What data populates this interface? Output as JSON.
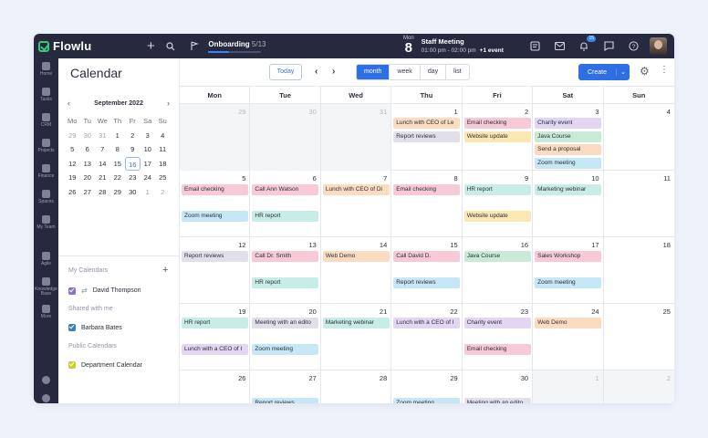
{
  "app": {
    "name": "Flowlu"
  },
  "topbar": {
    "onboarding_label": "Onboarding",
    "onboarding_count": "5/13",
    "onboarding_progress": 0.385,
    "meeting_day_name": "Mon",
    "meeting_day_num": "8",
    "meeting_title": "Staff Meeting",
    "meeting_time": "01:00 pm - 02:00 pm",
    "meeting_extra": "+1 event",
    "notif_badge": "15"
  },
  "sidenav": [
    {
      "label": "Home",
      "icon": "home-icon"
    },
    {
      "label": "Tasks",
      "icon": "tasks-icon"
    },
    {
      "label": "CRM",
      "icon": "crm-icon"
    },
    {
      "label": "Projects",
      "icon": "projects-icon"
    },
    {
      "label": "Finance",
      "icon": "finance-icon"
    },
    {
      "label": "Spaces",
      "icon": "spaces-icon"
    },
    {
      "label": "My Team",
      "icon": "team-icon"
    },
    {
      "label": "Agile",
      "icon": "agile-icon"
    },
    {
      "label": "Knowledge Base",
      "icon": "knowledge-icon"
    },
    {
      "label": "More",
      "icon": "more-icon"
    }
  ],
  "page": {
    "title": "Calendar"
  },
  "mini_calendar": {
    "month_label": "September 2022",
    "dows": [
      "Mo",
      "Tu",
      "We",
      "Th",
      "Fr",
      "Sa",
      "Su"
    ],
    "weeks": [
      [
        "29",
        "30",
        "31",
        "1",
        "2",
        "3",
        "4"
      ],
      [
        "5",
        "6",
        "7",
        "8",
        "9",
        "10",
        "11"
      ],
      [
        "12",
        "13",
        "14",
        "15",
        "16",
        "17",
        "18"
      ],
      [
        "19",
        "20",
        "21",
        "22",
        "23",
        "24",
        "25"
      ],
      [
        "26",
        "27",
        "28",
        "29",
        "30",
        "1",
        "2"
      ]
    ],
    "today": "16"
  },
  "calendars": {
    "my_label": "My Calendars",
    "my_items": [
      {
        "name": "David Thompson",
        "color": "#8b6fc9"
      }
    ],
    "shared_label": "Shared with me",
    "shared_items": [
      {
        "name": "Barbara Bates",
        "color": "#3a7fc1"
      }
    ],
    "public_label": "Public Calendars",
    "public_items": [
      {
        "name": "Department Calendar",
        "color": "#c9cf2e"
      }
    ]
  },
  "toolbar": {
    "today_label": "Today",
    "views": [
      "month",
      "week",
      "day",
      "list"
    ],
    "active_view": "month",
    "create_label": "Create"
  },
  "grid": {
    "dows": [
      "Mon",
      "Tue",
      "Wed",
      "Thu",
      "Fri",
      "Sat",
      "Sun"
    ],
    "weeks": [
      [
        {
          "n": "29",
          "out": true,
          "events": []
        },
        {
          "n": "30",
          "out": true,
          "events": []
        },
        {
          "n": "31",
          "out": true,
          "events": []
        },
        {
          "n": "1",
          "events": [
            {
              "t": "Lunch with CEO of Le",
              "c": "#fbdcc0"
            },
            {
              "t": "Report reviews",
              "c": "#e1e0ea"
            }
          ]
        },
        {
          "n": "2",
          "events": [
            {
              "t": "Email checking",
              "c": "#f8c9d6"
            },
            {
              "t": "Website update",
              "c": "#fbe7b2"
            }
          ]
        },
        {
          "n": "3",
          "events": [
            {
              "t": "Charity event",
              "c": "#e3d6f3"
            },
            {
              "t": "Java Course",
              "c": "#c8ead7"
            },
            {
              "t": "Send a proposal",
              "c": "#fbdcc0"
            },
            {
              "t": "Zoom meeting",
              "c": "#c6e7f6"
            }
          ]
        },
        {
          "n": "4",
          "events": []
        }
      ],
      [
        {
          "n": "5",
          "events": [
            {
              "t": "Email checking",
              "c": "#f8c9d6"
            },
            {
              "t": "Zoom meeting",
              "c": "#c6e7f6",
              "slot": 2
            }
          ]
        },
        {
          "n": "6",
          "events": [
            {
              "t": "Call Ann Watson",
              "c": "#f8c9d6"
            },
            {
              "t": "HR report",
              "c": "#c7ede6",
              "slot": 2
            }
          ]
        },
        {
          "n": "7",
          "events": [
            {
              "t": "Lunch with CEO of Di",
              "c": "#fbdcc0"
            }
          ]
        },
        {
          "n": "8",
          "events": [
            {
              "t": "Email checking",
              "c": "#f8c9d6"
            }
          ]
        },
        {
          "n": "9",
          "events": [
            {
              "t": "HR report",
              "c": "#c7ede6"
            },
            {
              "t": "Website update",
              "c": "#fbe7b2",
              "slot": 2
            }
          ]
        },
        {
          "n": "10",
          "events": [
            {
              "t": "Marketing webinar",
              "c": "#c7ede6"
            }
          ]
        },
        {
          "n": "11",
          "events": []
        }
      ],
      [
        {
          "n": "12",
          "events": [
            {
              "t": "Report reviews",
              "c": "#e1e0ea"
            }
          ]
        },
        {
          "n": "13",
          "events": [
            {
              "t": "Call Dr. Smith",
              "c": "#f8c9d6"
            },
            {
              "t": "HR report",
              "c": "#c7ede6",
              "slot": 2
            }
          ]
        },
        {
          "n": "14",
          "events": [
            {
              "t": "Web Demo",
              "c": "#fbdcc0"
            }
          ]
        },
        {
          "n": "15",
          "events": [
            {
              "t": "Call David D.",
              "c": "#f8c9d6"
            },
            {
              "t": "Report reviews",
              "c": "#c6e7f6",
              "slot": 2
            }
          ]
        },
        {
          "n": "16",
          "events": [
            {
              "t": "Java Course",
              "c": "#c8ead7"
            }
          ]
        },
        {
          "n": "17",
          "events": [
            {
              "t": "Sales Workshop",
              "c": "#f8c9d6"
            },
            {
              "t": "Zoom meeting",
              "c": "#c6e7f6",
              "slot": 2
            }
          ]
        },
        {
          "n": "18",
          "events": []
        }
      ],
      [
        {
          "n": "19",
          "events": [
            {
              "t": "HR report",
              "c": "#c7ede6"
            },
            {
              "t": "Lunch with a CEO of I",
              "c": "#e3d6f3",
              "slot": 2
            }
          ]
        },
        {
          "n": "20",
          "events": [
            {
              "t": "Meeting with an edito",
              "c": "#e1e0ea"
            },
            {
              "t": "Zoom meeting",
              "c": "#c6e7f6",
              "slot": 2
            }
          ]
        },
        {
          "n": "21",
          "events": [
            {
              "t": "Marketing webinar",
              "c": "#c7ede6"
            }
          ]
        },
        {
          "n": "22",
          "events": [
            {
              "t": "Lunch with a CEO of I",
              "c": "#e3d6f3"
            }
          ]
        },
        {
          "n": "23",
          "events": [
            {
              "t": "Charity event",
              "c": "#e3d6f3"
            },
            {
              "t": "Email checking",
              "c": "#f8c9d6",
              "slot": 2
            }
          ]
        },
        {
          "n": "24",
          "events": [
            {
              "t": "Web Demo",
              "c": "#fbdcc0"
            }
          ]
        },
        {
          "n": "25",
          "events": []
        }
      ],
      [
        {
          "n": "26",
          "events": []
        },
        {
          "n": "27",
          "events": [
            {
              "t": "Report reviews",
              "c": "#c6e7f6",
              "slot": 1
            }
          ]
        },
        {
          "n": "28",
          "events": []
        },
        {
          "n": "29",
          "events": [
            {
              "t": "Zoom meeting",
              "c": "#c6e7f6",
              "slot": 1
            }
          ]
        },
        {
          "n": "30",
          "events": [
            {
              "t": "Meeting with an edito",
              "c": "#e1e0ea",
              "slot": 1
            }
          ]
        },
        {
          "n": "1",
          "out": true,
          "events": []
        },
        {
          "n": "2",
          "out": true,
          "events": []
        }
      ]
    ]
  }
}
